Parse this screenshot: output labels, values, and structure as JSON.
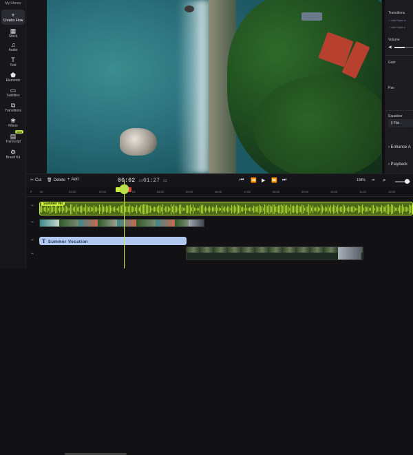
{
  "sidebar": {
    "top_label": "My Library",
    "items": [
      {
        "icon": "+",
        "icon_name": "plus-sparkle-icon",
        "label": "Creator Flow",
        "active": true
      },
      {
        "icon": "▦",
        "icon_name": "stock-icon",
        "label": "Stock"
      },
      {
        "icon": "♫",
        "icon_name": "music-note-icon",
        "label": "Audio"
      },
      {
        "icon": "T",
        "icon_name": "text-icon",
        "label": "Text"
      },
      {
        "icon": "⬟",
        "icon_name": "elements-icon",
        "label": "Elements"
      },
      {
        "icon": "▭",
        "icon_name": "subtitles-icon",
        "label": "Subtitles"
      },
      {
        "icon": "⧉",
        "icon_name": "transitions-icon",
        "label": "Transitions"
      },
      {
        "icon": "❀",
        "icon_name": "filters-icon",
        "label": "Filters"
      },
      {
        "icon": "▤",
        "icon_name": "transcript-icon",
        "label": "Transcript",
        "badge": "New"
      },
      {
        "icon": "⚙",
        "icon_name": "brand-kit-icon",
        "label": "Brand Kit"
      }
    ]
  },
  "right_panel": {
    "transitions_label": "Transitions",
    "add_fade_in": "+ Add Fade in",
    "add_fade_out": "+ Add Fade o",
    "volume_label": "Volume",
    "volume_level": 0.55,
    "gain_label": "Gain",
    "pan_label": "Pan",
    "equalizer_label": "Equalizer",
    "equalizer_value": "Flat",
    "enhance_label": "Enhance A",
    "playback_label": "Playback"
  },
  "toolbar": {
    "cut": "Cut",
    "delete": "Delete",
    "add": "Add",
    "current_time": "00:02",
    "current_frames": "26",
    "total_time": "01:27",
    "total_frames": "22",
    "zoom": "108%"
  },
  "ruler": {
    "labels": [
      "00",
      "01:00",
      "02:00",
      "03",
      "04:00",
      "05:00",
      "06:00",
      "07:00",
      "08:00",
      "09:00",
      "10:00",
      "11:00",
      "12:00",
      "13:00",
      "14:00"
    ]
  },
  "tracks": {
    "audio_clip_name": "Summer Hit",
    "text_clip_name": "Summer Vocation"
  },
  "colors": {
    "accent": "#c9ef3b",
    "audio_clip_bg": "#4d6a1a",
    "text_clip_bg": "#b3c8f0",
    "panel_bg": "#1b1b20"
  }
}
